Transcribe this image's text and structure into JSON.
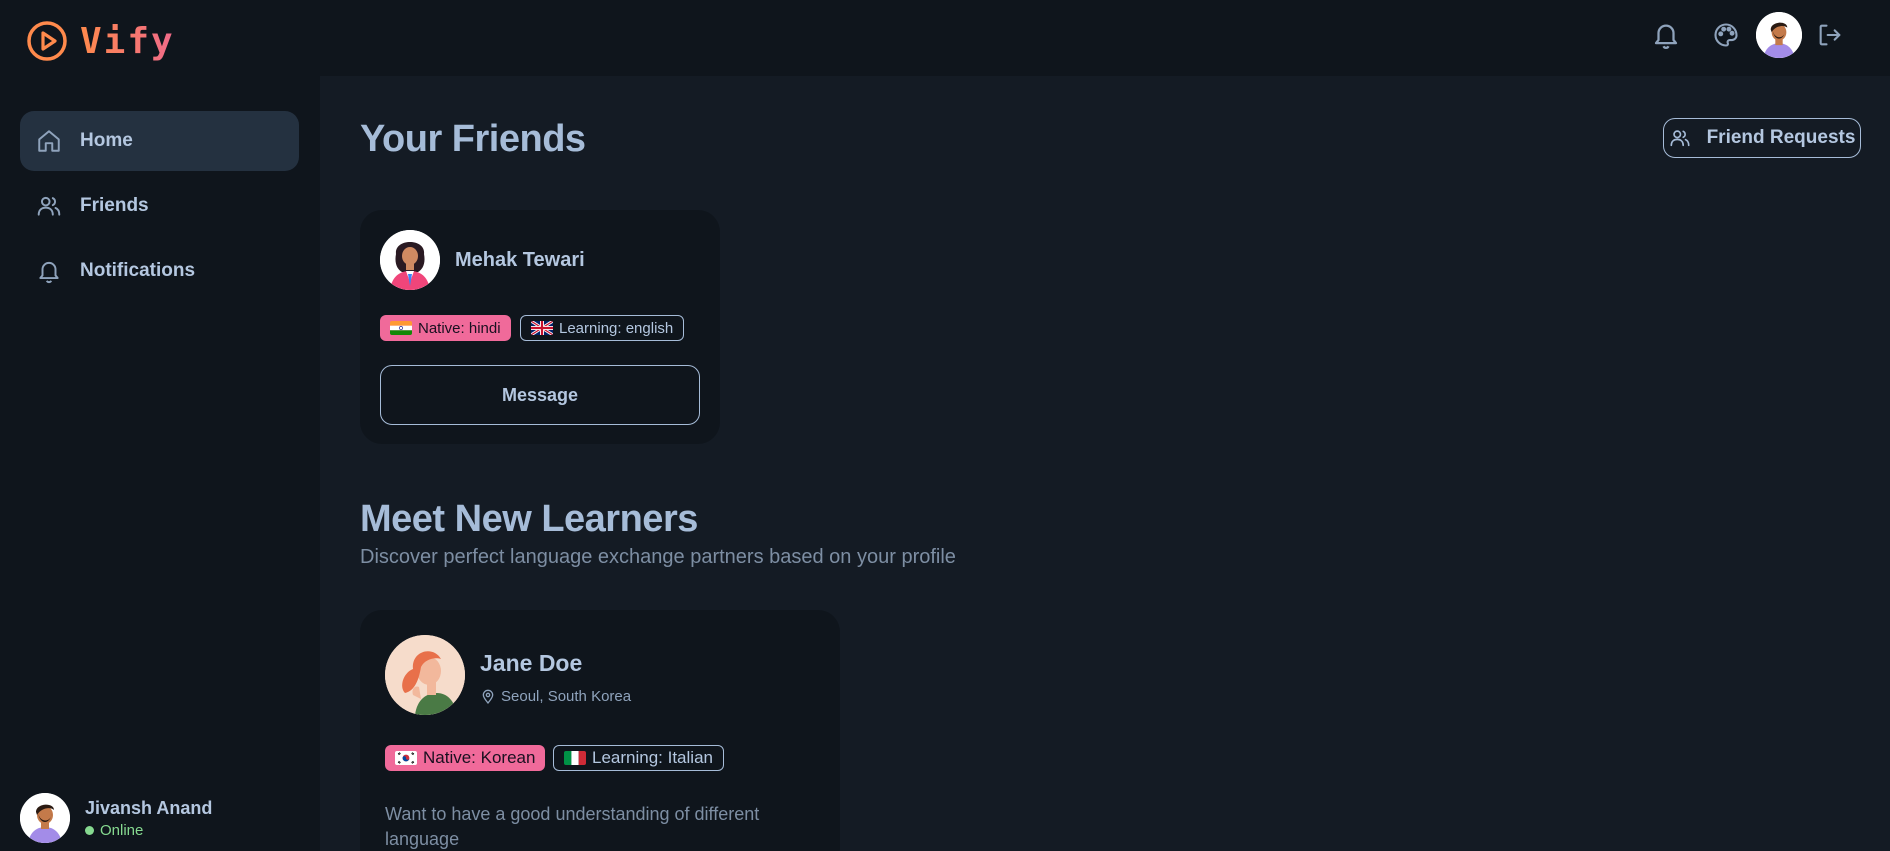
{
  "app": {
    "name": "Vify"
  },
  "sidebar": {
    "items": [
      {
        "label": "Home",
        "icon": "home-icon",
        "active": true
      },
      {
        "label": "Friends",
        "icon": "users-icon",
        "active": false
      },
      {
        "label": "Notifications",
        "icon": "bell-icon",
        "active": false
      }
    ],
    "user": {
      "name": "Jivansh Anand",
      "status": "Online"
    }
  },
  "topbar": {
    "icons": [
      "bell-icon",
      "palette-icon",
      "avatar",
      "logout-icon"
    ]
  },
  "friends": {
    "title": "Your Friends",
    "requests_label": "Friend Requests",
    "cards": [
      {
        "name": "Mehak Tewari",
        "native": "Native: hindi",
        "learning": "Learning: english",
        "message_label": "Message"
      }
    ]
  },
  "learners": {
    "title": "Meet New Learners",
    "subtitle": "Discover perfect language exchange partners based on your profile",
    "cards": [
      {
        "name": "Jane Doe",
        "location": "Seoul, South Korea",
        "native": "Native: Korean",
        "learning": "Learning: Italian",
        "bio": "Want to have a good understanding of different language"
      }
    ]
  },
  "colors": {
    "background": "#141b24",
    "sidebar": "#0f151c",
    "accent_pink": "#f06a9a",
    "accent_orange": "#ff8a4c",
    "online_green": "#86d990"
  }
}
